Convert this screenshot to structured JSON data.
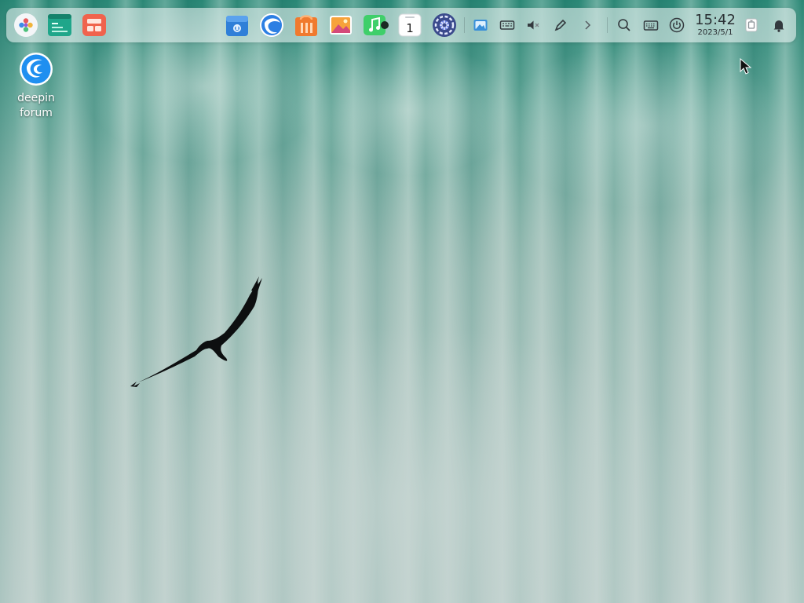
{
  "taskbar": {
    "clock_time": "15:42",
    "clock_date": "2023/5/1",
    "left_icons": [
      "launcher-icon",
      "terminal-icon",
      "multitask-view-icon"
    ],
    "app_icons": [
      "file-manager-icon",
      "browser-icon",
      "app-store-icon",
      "image-viewer-icon",
      "music-icon",
      "calendar-icon",
      "control-center-icon"
    ],
    "calendar_day": "1",
    "tray_icons": [
      "screenshot-icon",
      "keyboard-icon",
      "volume-muted-icon",
      "pen-icon",
      "expand-arrow-icon",
      "search-icon",
      "onscreen-keyboard-icon",
      "power-icon",
      "trash-icon",
      "notification-bell-icon"
    ]
  },
  "desktop": {
    "icons": [
      {
        "label": "deepin forum",
        "icon": "deepin-logo-icon"
      }
    ]
  },
  "colors": {
    "panel_bg": "#e1eeec",
    "accent_blue": "#2f7fd8",
    "wallpaper_teal": "#2e8c7a"
  }
}
